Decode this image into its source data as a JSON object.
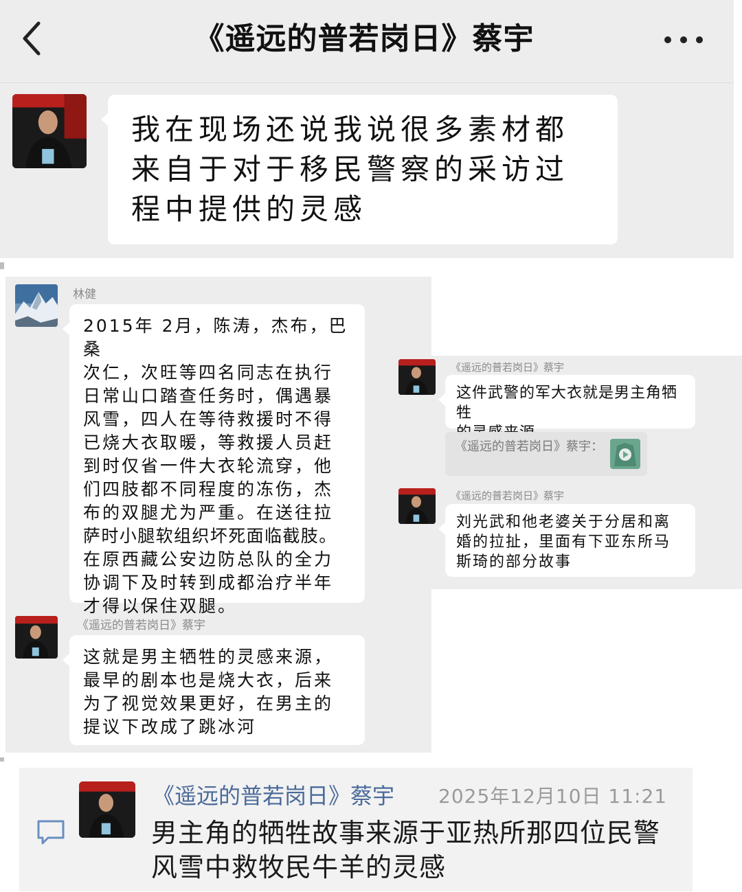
{
  "header": {
    "title": "《遥远的普若岗日》蔡宇"
  },
  "panel1": {
    "message_lines": [
      "我在现场还说我说很多素材都",
      "来自于对于移民警察的采访过",
      "程中提供的灵感"
    ]
  },
  "panel2": {
    "msg1": {
      "sender": "林健",
      "lines": [
        "2015年 2月，陈涛，杰布，巴桑",
        "次仁，次旺等四名同志在执行",
        "日常山口踏查任务时，偶遇暴",
        "风雪，四人在等待救援时不得",
        "已烧大衣取暖，等救援人员赶",
        "到时仅省一件大衣轮流穿，他",
        "们四肢都不同程度的冻伤，杰",
        "布的双腿尤为严重。在送往拉",
        "萨时小腿软组织坏死面临截肢。",
        "在原西藏公安边防总队的全力",
        "协调下及时转到成都治疗半年",
        "才得以保住双腿。"
      ]
    },
    "msg2": {
      "sender": "《遥远的普若岗日》蔡宇",
      "lines": [
        "这就是男主牺牲的灵感来源，",
        "最早的剧本也是烧大衣，后来",
        "为了视觉效果更好，在男主的",
        "提议下改成了跳冰河"
      ]
    }
  },
  "panel3": {
    "msg1": {
      "sender": "《遥远的普若岗日》蔡宇",
      "lines": [
        "这件武警的军大衣就是男主角牺牲",
        "的灵感来源"
      ]
    },
    "quote": {
      "label": "《遥远的普若岗日》蔡宇："
    },
    "msg2": {
      "sender": "《遥远的普若岗日》蔡宇",
      "lines": [
        "刘光武和他老婆关于分居和离",
        "婚的拉扯，里面有下亚东所马",
        "斯琦的部分故事"
      ]
    }
  },
  "comment": {
    "name": "《遥远的普若岗日》蔡宇",
    "time": "2025年12月10日 11:21",
    "lines": [
      "男主角的牺牲故事来源于亚热所那四位民警",
      "风雪中救牧民牛羊的灵感"
    ]
  },
  "icons": {
    "back": "chevron-left-icon",
    "more": "more-dots-icon",
    "comment": "comment-bubble-icon",
    "play": "play-icon"
  },
  "colors": {
    "chat_bg": "#ededed",
    "bubble": "#ffffff",
    "comment_name": "#4a6a9a",
    "meta_gray": "#9a9a9a"
  }
}
